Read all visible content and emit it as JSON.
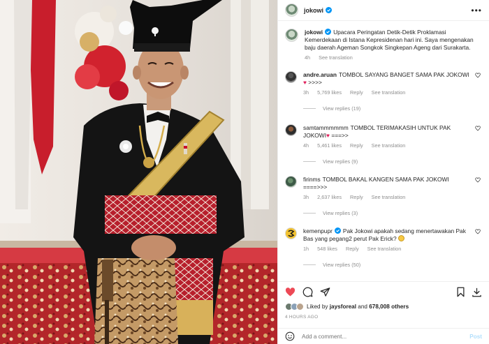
{
  "colors": {
    "accent": "#0095f6",
    "like_red": "#ed4956",
    "muted": "#8e8e8e"
  },
  "post": {
    "username": "jokowi",
    "more_icon": "more-horizontal-icon"
  },
  "caption": {
    "username": "jokowi",
    "text": "Upacara Peringatan Detik-Detik Proklamasi Kemerdekaan di Istana Kepresidenan hari ini. Saya mengenakan baju daerah Ageman Songkok Singkepan Ageng dari Surakarta.",
    "time": "4h",
    "translate": "See translation"
  },
  "comments": [
    {
      "username": "andre.aruan",
      "text": "TOMBOL SAYANG BANGET SAMA PAK JOKOWI",
      "text_tail": " >>>>",
      "time": "3h",
      "likes": "5,769 likes",
      "reply": "Reply",
      "translate": "See translation",
      "view_replies": "View replies (19)"
    },
    {
      "username": "samtammmmmm",
      "text": "TOMBOL TERIMAKASIH UNTUK PAK JOKOWI",
      "text_tail": " ===>>",
      "time": "4h",
      "likes": "5,461 likes",
      "reply": "Reply",
      "translate": "See translation",
      "view_replies": "View replies (9)"
    },
    {
      "username": "firinms",
      "text": "TOMBOL BAKAL KANGEN SAMA PAK JOKOWI ====>>>",
      "time": "3h",
      "likes": "2,637 likes",
      "reply": "Reply",
      "translate": "See translation",
      "view_replies": "View replies (3)"
    },
    {
      "username": "kemenpupr",
      "text": "Pak Jokowi apakah sedang menertawakan Pak Bas yang pegang2 perut Pak Erick?",
      "time": "1h",
      "likes": "548 likes",
      "reply": "Reply",
      "translate": "See translation",
      "view_replies": "View replies (50)"
    }
  ],
  "likes_line": {
    "prefix": "Liked by",
    "user": "jaysforeal",
    "and": "and",
    "count": "678,008 others"
  },
  "timestamp": "4 HOURS AGO",
  "add_comment": {
    "placeholder": "Add a comment...",
    "post_label": "Post"
  }
}
